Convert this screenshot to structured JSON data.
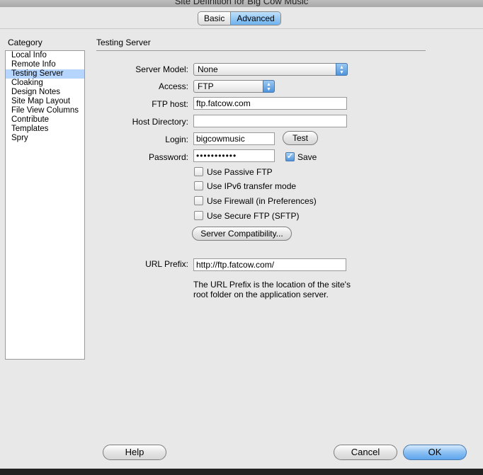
{
  "window": {
    "title": "Site Definition for Big Cow Music"
  },
  "mode_tabs": [
    {
      "label": "Basic"
    },
    {
      "label": "Advanced"
    }
  ],
  "category": {
    "title": "Category",
    "items": [
      {
        "label": "Local Info"
      },
      {
        "label": "Remote Info"
      },
      {
        "label": "Testing Server"
      },
      {
        "label": "Cloaking"
      },
      {
        "label": "Design Notes"
      },
      {
        "label": "Site Map Layout"
      },
      {
        "label": "File View Columns"
      },
      {
        "label": "Contribute"
      },
      {
        "label": "Templates"
      },
      {
        "label": "Spry"
      }
    ],
    "selected": "Testing Server"
  },
  "form": {
    "section_title": "Testing Server",
    "server_model": {
      "label": "Server Model:",
      "value": "None"
    },
    "access": {
      "label": "Access:",
      "value": "FTP"
    },
    "ftp_host": {
      "label": "FTP host:",
      "value": "ftp.fatcow.com"
    },
    "host_directory": {
      "label": "Host Directory:",
      "value": ""
    },
    "login": {
      "label": "Login:",
      "value": "bigcowmusic",
      "test_label": "Test"
    },
    "password": {
      "label": "Password:",
      "value": "•••••••••••",
      "save_label": "Save",
      "save_checked": true
    },
    "options": [
      {
        "label": "Use Passive FTP",
        "checked": false
      },
      {
        "label": "Use IPv6 transfer mode",
        "checked": false
      },
      {
        "label": "Use Firewall (in Preferences)",
        "checked": false
      },
      {
        "label": "Use Secure FTP (SFTP)",
        "checked": false
      }
    ],
    "compat_button": "Server Compatibility...",
    "url_prefix": {
      "label": "URL Prefix:",
      "value": "http://ftp.fatcow.com/"
    },
    "note_line1": "The URL Prefix is the location of the site's",
    "note_line2": "root folder on the application server."
  },
  "footer": {
    "help": "Help",
    "cancel": "Cancel",
    "ok": "OK"
  }
}
